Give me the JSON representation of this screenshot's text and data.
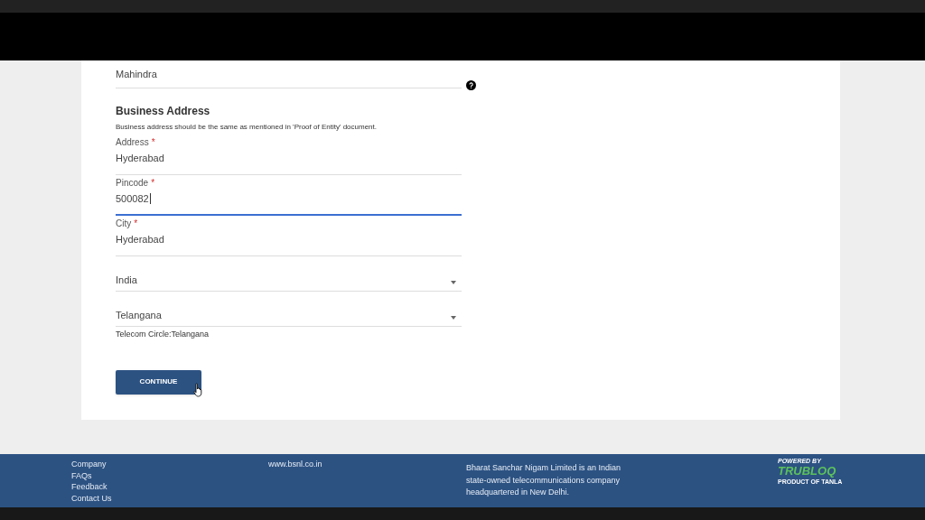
{
  "form": {
    "top_field": {
      "value": "Mahindra"
    },
    "section_title": "Business Address",
    "note": "Business address should be the same as mentioned in 'Proof of Entity' document.",
    "fields": [
      {
        "label": "Address",
        "required_mark": "*",
        "value": "Hyderabad",
        "focused": false
      },
      {
        "label": "Pincode",
        "required_mark": "*",
        "value": "500082",
        "focused": true
      },
      {
        "label": "City",
        "required_mark": "*",
        "value": "Hyderabad",
        "focused": false
      }
    ],
    "selects": [
      {
        "value": "India"
      },
      {
        "value": "Telangana"
      }
    ],
    "circle_note": "Telecom Circle:Telangana",
    "button": "CONTINUE"
  },
  "footer": {
    "links": [
      "Company",
      "FAQs",
      "Feedback",
      "Contact Us"
    ],
    "website": "www.bsnl.co.in",
    "about": "Bharat Sanchar Nigam Limited is an Indian state-owned telecommunications company headquartered in New Delhi.",
    "badge": {
      "top": "POWERED BY",
      "brand": "TRUBLOQ",
      "bottom": "PRODUCT OF TANLA"
    }
  }
}
